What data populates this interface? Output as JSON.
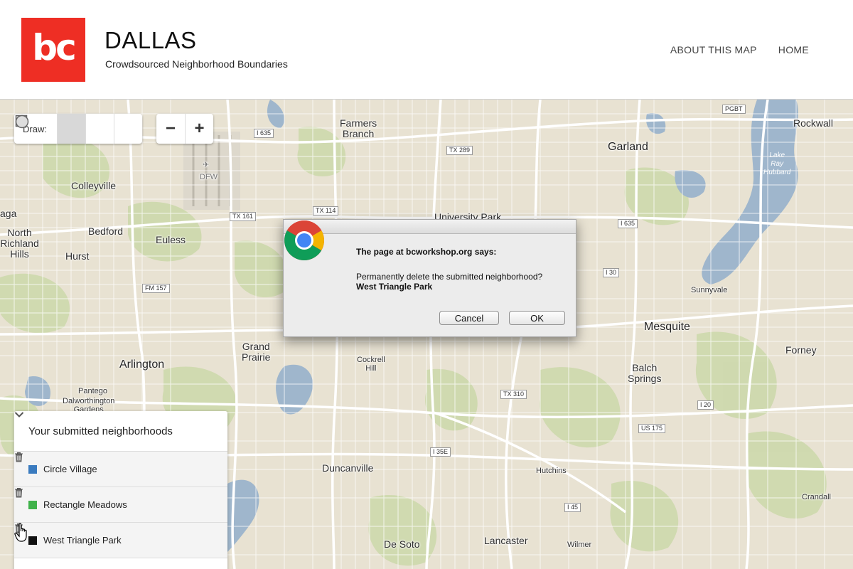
{
  "header": {
    "logo_text": "bc",
    "title": "DALLAS",
    "subtitle": "Crowdsourced Neighborhood Boundaries",
    "nav": [
      "ABOUT THIS MAP",
      "HOME"
    ]
  },
  "toolbar": {
    "draw_label": "Draw:",
    "tools": [
      "polygon-icon",
      "square-icon",
      "circle-icon"
    ],
    "zoom_out": "−",
    "zoom_in": "+"
  },
  "map": {
    "places": {
      "farmers_branch": "Farmers\nBranch",
      "garland": "Garland",
      "rockwall": "Rockwall",
      "colleyville": "Colleyville",
      "bedford": "Bedford",
      "euless": "Euless",
      "hurst": "Hurst",
      "north_richland_hills": "North\nRichland\nHills",
      "ga": "aga",
      "university_park": "University Park",
      "sunnyvale": "Sunnyvale",
      "mesquite": "Mesquite",
      "forney": "Forney",
      "grand_prairie": "Grand\nPrairie",
      "cockrell_hill": "Cockrell\nHill",
      "arlington": "Arlington",
      "pantego": "Pantego",
      "dalworthington_gardens": "Dalworthington\nGardens",
      "balch_springs": "Balch\nSprings",
      "duncanville": "Duncanville",
      "hutchins": "Hutchins",
      "crandall": "Crandall",
      "de_soto": "De Soto",
      "lancaster": "Lancaster",
      "wilmer": "Wilmer",
      "dfw": "DFW",
      "lake_ray_hubbard": "Lake\nRay\nHubbard"
    },
    "shields": {
      "i635_w": "I 635",
      "tx289": "TX 289",
      "pgbt": "PGBT",
      "tx161": "TX 161",
      "tx114": "TX 114",
      "i635_e": "I 635",
      "i30": "I 30",
      "fm157": "FM 157",
      "tx310": "TX 310",
      "i20": "I 20",
      "us175": "US 175",
      "i35e": "I 35E",
      "i45": "I 45"
    }
  },
  "panel": {
    "title": "Your submitted neighborhoods",
    "items": [
      {
        "label": "Circle Village",
        "color": "#3a7bbf"
      },
      {
        "label": "Rectangle Meadows",
        "color": "#3fb24a"
      },
      {
        "label": "West Triangle Park",
        "color": "#111111"
      }
    ]
  },
  "dialog": {
    "title": "The page at bcworkshop.org says:",
    "message": "Permanently delete the submitted neighborhood?",
    "name": "West Triangle Park",
    "cancel": "Cancel",
    "ok": "OK"
  },
  "colors": {
    "brand": "#ee2e24",
    "map_land": "#e8e2d2",
    "map_water": "#9fb6cc",
    "map_park": "#c8d6a8"
  }
}
